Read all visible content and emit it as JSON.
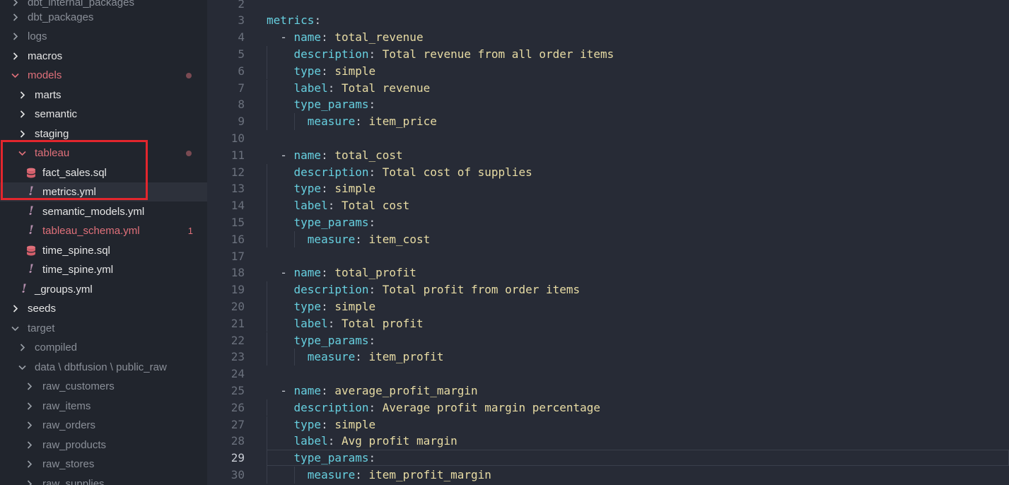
{
  "colors": {
    "sidebar_bg": "#21252d",
    "editor_bg": "#272b36",
    "yaml_key": "#67d0e0",
    "yaml_value": "#e8dca4",
    "modified_red": "#e0707a",
    "highlight_box": "#e3262d"
  },
  "explorer": {
    "items": [
      {
        "label": "dbt_internal_packages",
        "state": "collapsed",
        "style": "dim"
      },
      {
        "label": "dbt_packages",
        "state": "collapsed",
        "style": "dim"
      },
      {
        "label": "logs",
        "state": "collapsed",
        "style": "dim"
      },
      {
        "label": "macros",
        "state": "collapsed",
        "style": "white"
      },
      {
        "label": "models",
        "state": "expanded",
        "style": "red",
        "modified": true
      },
      {
        "label": "marts",
        "state": "collapsed",
        "style": "white"
      },
      {
        "label": "semantic",
        "state": "collapsed",
        "style": "white"
      },
      {
        "label": "staging",
        "state": "collapsed",
        "style": "white"
      },
      {
        "label": "tableau",
        "state": "expanded",
        "style": "red",
        "modified": true
      },
      {
        "label": "fact_sales.sql",
        "icon": "database-icon",
        "style": "white"
      },
      {
        "label": "metrics.yml",
        "icon": "yaml-icon",
        "style": "white",
        "selected": true
      },
      {
        "label": "semantic_models.yml",
        "icon": "yaml-icon",
        "style": "white"
      },
      {
        "label": "tableau_schema.yml",
        "icon": "yaml-icon",
        "style": "red",
        "badge": "1"
      },
      {
        "label": "time_spine.sql",
        "icon": "database-icon",
        "style": "white"
      },
      {
        "label": "time_spine.yml",
        "icon": "yaml-icon",
        "style": "white"
      },
      {
        "label": "_groups.yml",
        "icon": "yaml-icon",
        "style": "white"
      },
      {
        "label": "seeds",
        "state": "collapsed",
        "style": "white"
      },
      {
        "label": "target",
        "state": "expanded",
        "style": "dim"
      },
      {
        "label": "compiled",
        "state": "collapsed",
        "style": "dim"
      },
      {
        "label": "data \\ dbtfusion \\ public_raw",
        "state": "expanded",
        "style": "dim"
      },
      {
        "label": "raw_customers",
        "state": "collapsed",
        "style": "dim"
      },
      {
        "label": "raw_items",
        "state": "collapsed",
        "style": "dim"
      },
      {
        "label": "raw_orders",
        "state": "collapsed",
        "style": "dim"
      },
      {
        "label": "raw_products",
        "state": "collapsed",
        "style": "dim"
      },
      {
        "label": "raw_stores",
        "state": "collapsed",
        "style": "dim"
      },
      {
        "label": "raw_supplies",
        "state": "collapsed",
        "style": "dim"
      }
    ]
  },
  "editor": {
    "active_line": 29,
    "lines": [
      {
        "num": "2",
        "key": "",
        "value": ""
      },
      {
        "num": "3",
        "key": "metrics",
        "value": ""
      },
      {
        "num": "4",
        "dash": true,
        "key": "name",
        "value": "total_revenue"
      },
      {
        "num": "5",
        "key": "description",
        "value": "Total revenue from all order items"
      },
      {
        "num": "6",
        "key": "type",
        "value": "simple"
      },
      {
        "num": "7",
        "key": "label",
        "value": "Total revenue"
      },
      {
        "num": "8",
        "key": "type_params",
        "value": ""
      },
      {
        "num": "9",
        "key": "measure",
        "value": "item_price"
      },
      {
        "num": "10",
        "key": "",
        "value": ""
      },
      {
        "num": "11",
        "dash": true,
        "key": "name",
        "value": "total_cost"
      },
      {
        "num": "12",
        "key": "description",
        "value": "Total cost of supplies"
      },
      {
        "num": "13",
        "key": "type",
        "value": "simple"
      },
      {
        "num": "14",
        "key": "label",
        "value": "Total cost"
      },
      {
        "num": "15",
        "key": "type_params",
        "value": ""
      },
      {
        "num": "16",
        "key": "measure",
        "value": "item_cost"
      },
      {
        "num": "17",
        "key": "",
        "value": ""
      },
      {
        "num": "18",
        "dash": true,
        "key": "name",
        "value": "total_profit"
      },
      {
        "num": "19",
        "key": "description",
        "value": "Total profit from order items"
      },
      {
        "num": "20",
        "key": "type",
        "value": "simple"
      },
      {
        "num": "21",
        "key": "label",
        "value": "Total profit"
      },
      {
        "num": "22",
        "key": "type_params",
        "value": ""
      },
      {
        "num": "23",
        "key": "measure",
        "value": "item_profit"
      },
      {
        "num": "24",
        "key": "",
        "value": ""
      },
      {
        "num": "25",
        "dash": true,
        "key": "name",
        "value": "average_profit_margin"
      },
      {
        "num": "26",
        "key": "description",
        "value": "Average profit margin percentage"
      },
      {
        "num": "27",
        "key": "type",
        "value": "simple"
      },
      {
        "num": "28",
        "key": "label",
        "value": "Avg profit margin"
      },
      {
        "num": "29",
        "key": "type_params",
        "value": ""
      },
      {
        "num": "30",
        "key": "measure",
        "value": "item_profit_margin"
      }
    ]
  }
}
